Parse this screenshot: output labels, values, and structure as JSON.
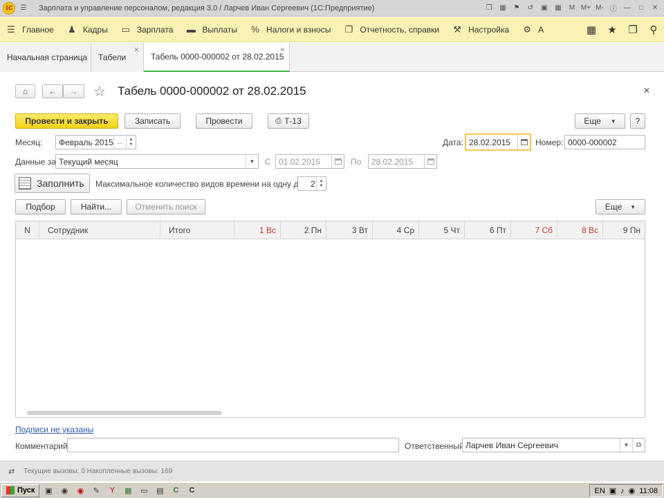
{
  "window": {
    "title": "Зарплата и управление персоналом, редакция 3.0 / Ларчев Иван Сергеевич  (1С:Предприятие)",
    "app_logo_text": "1С",
    "title_right_icons": [
      "copy-icon",
      "tile-icon",
      "bookmark-icon",
      "history-icon",
      "calendar-icon",
      "calc-icon",
      "memory-m-icon",
      "memory-mplus-icon",
      "memory-mminus-icon",
      "info-icon",
      "minimize-icon",
      "maximize-icon",
      "close-icon"
    ]
  },
  "main_menu": {
    "items": [
      {
        "label": "Главное",
        "icon": "hamburger-icon"
      },
      {
        "label": "Кадры",
        "icon": "people-icon"
      },
      {
        "label": "Зарплата",
        "icon": "money-icon"
      },
      {
        "label": "Выплаты",
        "icon": "payments-icon"
      },
      {
        "label": "Налоги и взносы",
        "icon": "percent-icon"
      },
      {
        "label": "Отчетность, справки",
        "icon": "reports-icon"
      },
      {
        "label": "Настройка",
        "icon": "wrench-icon"
      },
      {
        "label": "А",
        "icon": "gear-icon"
      }
    ],
    "tools": [
      "apps-grid-icon",
      "favorites-star-icon",
      "history-icon",
      "search-icon"
    ]
  },
  "tabs": [
    {
      "label": "Начальная страница",
      "closable": false,
      "active": false
    },
    {
      "label": "Табели",
      "closable": true,
      "active": false
    },
    {
      "label": "Табель 0000-000002 от 28.02.2015",
      "closable": true,
      "active": true
    }
  ],
  "form": {
    "title": "Табель 0000-000002 от 28.02.2015",
    "buttons": {
      "post_close": "Провести и закрыть",
      "save": "Записать",
      "post": "Провести",
      "print_t13": "Т-13",
      "more": "Еще",
      "help": "?"
    },
    "month_label": "Месяц:",
    "month_value": "Февраль 2015",
    "date_label": "Дата:",
    "date_value": "28.02.2015",
    "number_label": "Номер:",
    "number_value": "0000-000002",
    "data_for_label": "Данные за:",
    "data_for_value": "Текущий месяц",
    "from_label": "С",
    "from_value": "01.02.2015",
    "to_label": "По",
    "to_value": "28.02.2015",
    "fill_button": "Заполнить",
    "max_kinds_label": "Максимальное количество видов времени на одну дату:",
    "max_kinds_value": "2",
    "table_buttons": {
      "select": "Подбор",
      "find": "Найти...",
      "cancel_search": "Отменить поиск",
      "more": "Еще"
    },
    "table": {
      "columns": [
        {
          "label": "N",
          "weekend": false
        },
        {
          "label": "Сотрудник",
          "weekend": false
        },
        {
          "label": "Итого",
          "weekend": false
        },
        {
          "label": "1 Вс",
          "weekend": true
        },
        {
          "label": "2 Пн",
          "weekend": false
        },
        {
          "label": "3 Вт",
          "weekend": false
        },
        {
          "label": "4 Ср",
          "weekend": false
        },
        {
          "label": "5 Чт",
          "weekend": false
        },
        {
          "label": "6 Пт",
          "weekend": false
        },
        {
          "label": "7 Сб",
          "weekend": true
        },
        {
          "label": "8 Вс",
          "weekend": true
        },
        {
          "label": "9 Пн",
          "weekend": false
        }
      ],
      "rows": []
    },
    "signatures_link": "Подписи не указаны",
    "comment_label": "Комментарий:",
    "comment_value": "",
    "responsible_label": "Ответственный:",
    "responsible_value": "Ларчев Иван Сергеевич"
  },
  "status_bar": {
    "text": "Текущие вызовы: 0   Накопленные вызовы: 169"
  },
  "taskbar": {
    "start_label": "Пуск",
    "language": "EN",
    "clock": "11:08"
  },
  "colors": {
    "menu_bg": "#f9f2b4",
    "primary_button": "#f5d217",
    "active_tab_accent": "#3fae49",
    "weekend_text": "#c0392b",
    "link": "#2a5db0"
  }
}
